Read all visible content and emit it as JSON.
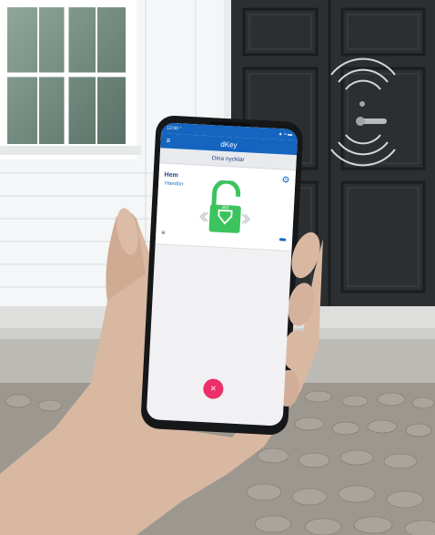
{
  "status_bar": {
    "time": "12:00 ᐟ",
    "indicators": "▲ ≈ ▬"
  },
  "app": {
    "menu_icon": "≡",
    "title": "dKey",
    "subtitle": "Dina nycklar"
  },
  "key_card": {
    "name": "Hem",
    "location": "Ytterdörr",
    "settings_icon": "⚙",
    "lock_badge": "BG"
  },
  "fab_icon": "×",
  "colors": {
    "primary": "#1565c0",
    "unlock_green": "#3dc35e",
    "fab_pink": "#ec2f6a"
  }
}
